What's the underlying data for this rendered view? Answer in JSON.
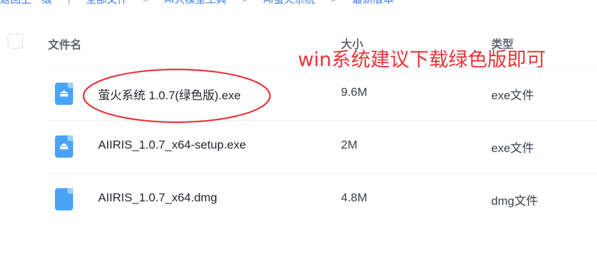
{
  "breadcrumb": {
    "items": [
      "返回上一级",
      "全部文件",
      "AI大模型工具",
      "AI萤火系统",
      "最新版本"
    ]
  },
  "header": {
    "name_label": "文件名",
    "size_label": "大小",
    "type_label": "类型"
  },
  "annotation": {
    "text": "win系统建议下载绿色版即可",
    "color": "#e8343b"
  },
  "files": [
    {
      "name": "萤火系统 1.0.7(绿色版).exe",
      "size": "9.6M",
      "type": "exe文件",
      "icon": "exe-file-icon"
    },
    {
      "name": "AIIRIS_1.0.7_x64-setup.exe",
      "size": "2M",
      "type": "exe文件",
      "icon": "exe-file-icon"
    },
    {
      "name": "AIIRIS_1.0.7_x64.dmg",
      "size": "4.8M",
      "type": "dmg文件",
      "icon": "apple-file-icon"
    }
  ],
  "colors": {
    "icon_blue": "#4aa3f6",
    "link_blue": "#3f7be8",
    "annotation_red": "#e8343b"
  }
}
